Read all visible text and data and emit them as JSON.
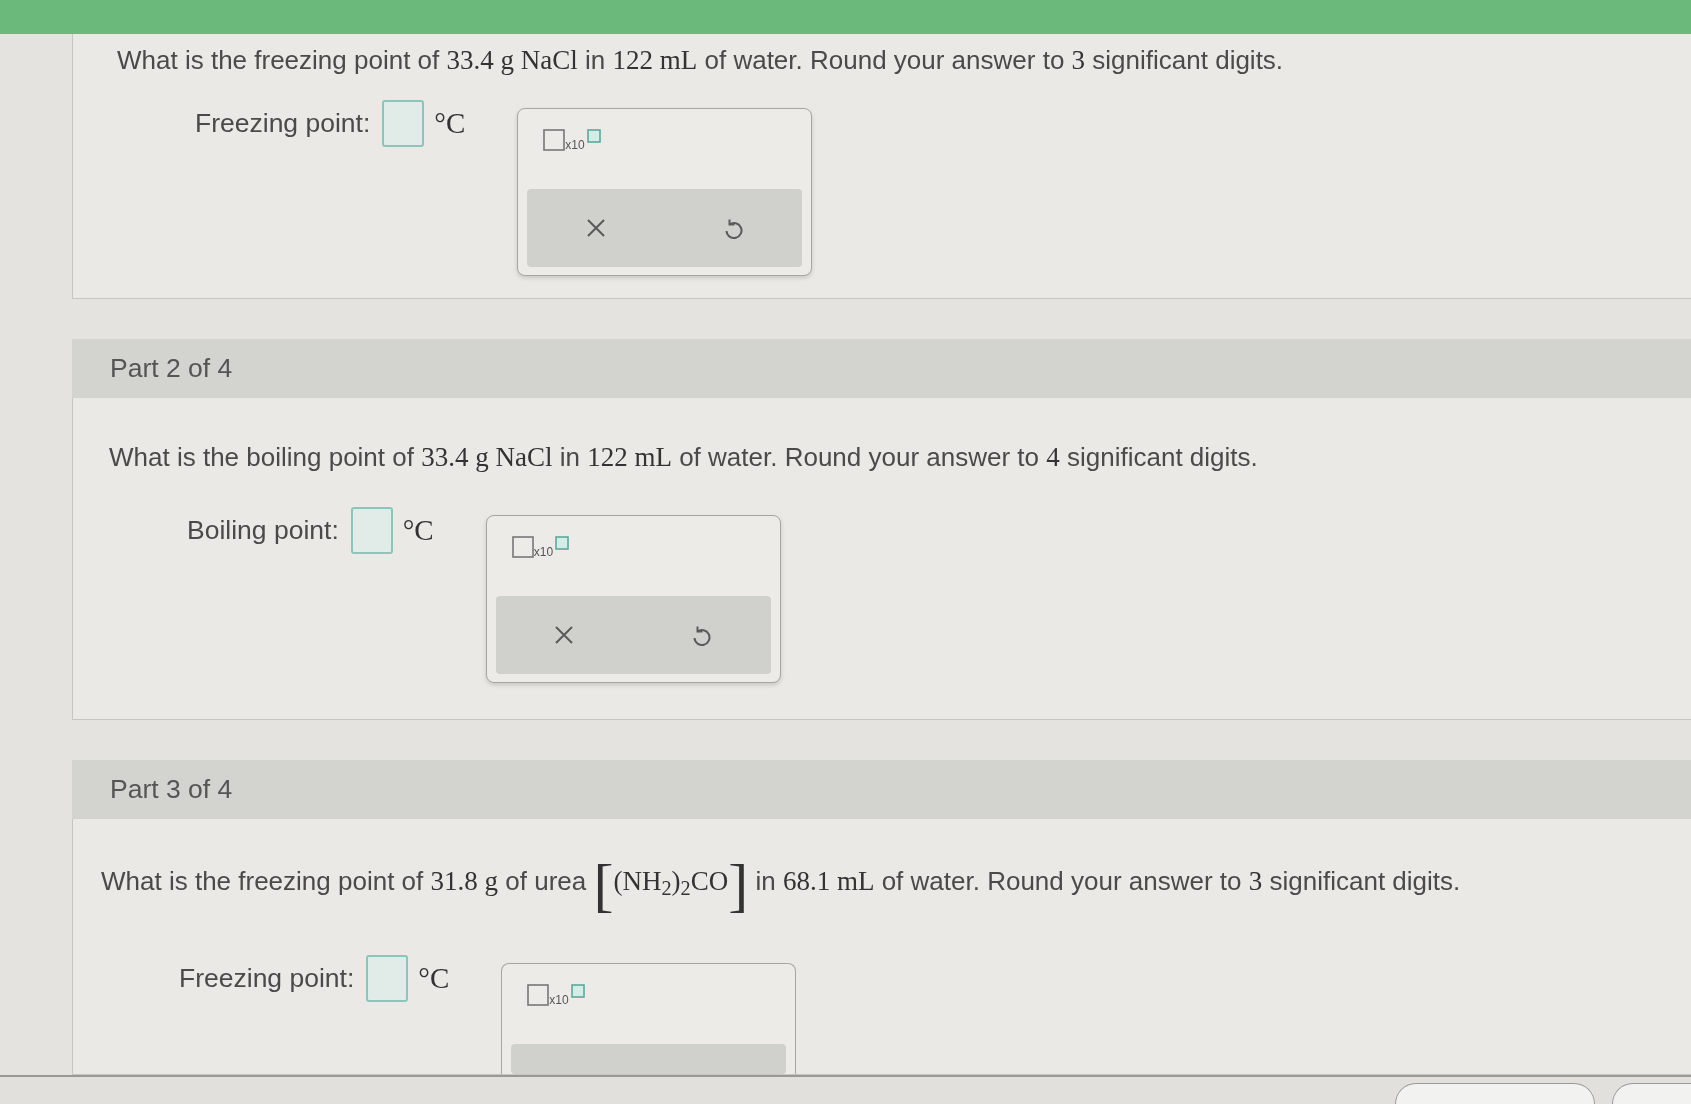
{
  "parts": [
    {
      "question": [
        {
          "kind": "text",
          "text": "What is the freezing point of"
        },
        {
          "kind": "math",
          "text": "33.4 g NaCl"
        },
        {
          "kind": "text",
          "text": "in"
        },
        {
          "kind": "math",
          "text": "122 mL"
        },
        {
          "kind": "text",
          "text": "of water. Round your answer to"
        },
        {
          "kind": "math",
          "text": "3"
        },
        {
          "kind": "text",
          "text": "significant digits."
        }
      ],
      "answer": {
        "label": "Freezing point:",
        "unit": "°C"
      },
      "keypad": {
        "template": "x10",
        "actions": [
          {
            "kind": "clear"
          },
          {
            "kind": "undo"
          }
        ]
      }
    },
    {
      "header": "Part 2 of 4",
      "question": [
        {
          "kind": "text",
          "text": "What is the boiling point of"
        },
        {
          "kind": "math",
          "text": "33.4 g NaCl"
        },
        {
          "kind": "text",
          "text": "in"
        },
        {
          "kind": "math",
          "text": "122 mL"
        },
        {
          "kind": "text",
          "text": "of water. Round your answer to"
        },
        {
          "kind": "math",
          "text": "4"
        },
        {
          "kind": "text",
          "text": "significant digits."
        }
      ],
      "answer": {
        "label": "Boiling point:",
        "unit": "°C"
      },
      "keypad": {
        "template": "x10",
        "actions": [
          {
            "kind": "clear"
          },
          {
            "kind": "undo"
          }
        ]
      }
    },
    {
      "header": "Part 3 of 4",
      "question": [
        {
          "kind": "text",
          "text": "What is the freezing point of"
        },
        {
          "kind": "math",
          "text": "31.8 g"
        },
        {
          "kind": "text",
          "text": "of urea"
        },
        {
          "kind": "bracketed",
          "open": "[",
          "text": "(NH$_{2}$)$_{2}$CO",
          "close": "]"
        },
        {
          "kind": "text",
          "text": "in"
        },
        {
          "kind": "math",
          "text": "68.1 mL"
        },
        {
          "kind": "text",
          "text": "of water. Round your answer to"
        },
        {
          "kind": "math",
          "text": "3"
        },
        {
          "kind": "text",
          "text": "significant digits."
        }
      ],
      "answer": {
        "label": "Freezing point:",
        "unit": "°C"
      },
      "keypad": {
        "template": "x10"
      }
    }
  ]
}
